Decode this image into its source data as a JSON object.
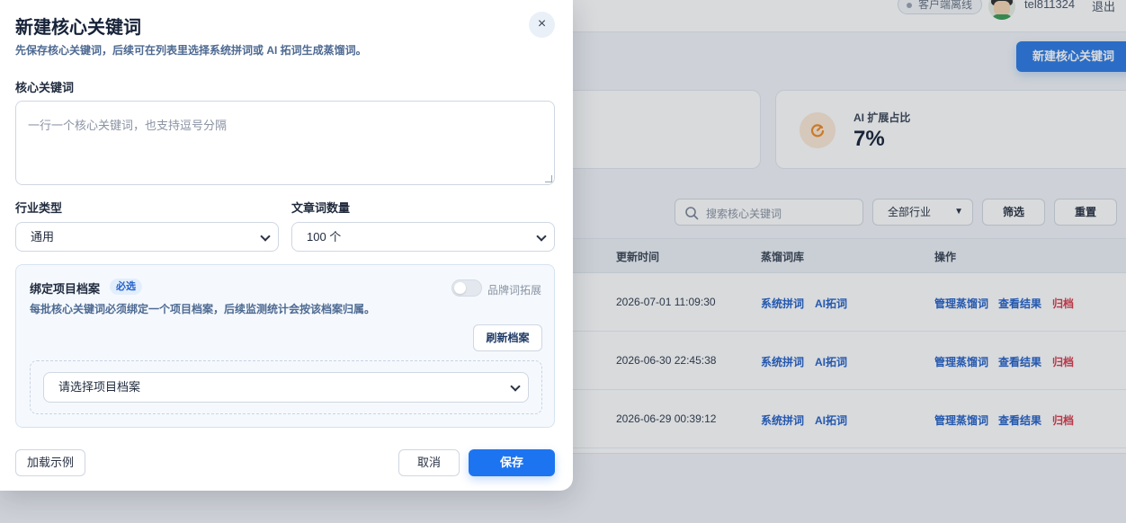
{
  "header": {
    "status": "客户端离线",
    "username": "tel811324",
    "logout": "退出",
    "new_keyword_button": "新建核心关键词"
  },
  "stats": {
    "ai_ratio_label": "AI 扩展占比",
    "ai_ratio_value": "7%",
    "accent": "#f08a24"
  },
  "filters": {
    "search_placeholder": "搜索核心关键词",
    "industry_value": "全部行业",
    "filter_button": "筛选",
    "reset_button": "重置"
  },
  "table": {
    "columns": [
      "更新时间",
      "蒸馏词库",
      "操作"
    ],
    "rows": [
      {
        "time": "2026-07-01 11:09:30",
        "lib_sys": "系统拼词",
        "lib_ai": "AI拓词",
        "act_manage": "管理蒸馏词",
        "act_view": "查看结果",
        "act_archive": "归档"
      },
      {
        "time": "2026-06-30 22:45:38",
        "lib_sys": "系统拼词",
        "lib_ai": "AI拓词",
        "act_manage": "管理蒸馏词",
        "act_view": "查看结果",
        "act_archive": "归档"
      },
      {
        "time": "2026-06-29 00:39:12",
        "lib_sys": "系统拼词",
        "lib_ai": "AI拓词",
        "act_manage": "管理蒸馏词",
        "act_view": "查看结果",
        "act_archive": "归档"
      }
    ]
  },
  "modal": {
    "title": "新建核心关键词",
    "subtitle": "先保存核心关键词，后续可在列表里选择系统拼词或 AI 拓词生成蒸馏词。",
    "close_icon": "×",
    "keyword_label": "核心关键词",
    "keyword_placeholder": "一行一个核心关键词，也支持逗号分隔",
    "industry_label": "行业类型",
    "industry_value": "通用",
    "count_label": "文章词数量",
    "count_value": "100 个",
    "project": {
      "title": "绑定项目档案",
      "required_badge": "必选",
      "toggle_label": "品牌词拓展",
      "toggle_on": false,
      "description": "每批核心关键词必须绑定一个项目档案，后续监测统计会按该档案归属。",
      "refresh_button": "刷新档案",
      "select_placeholder": "请选择项目档案"
    },
    "load_example_button": "加载示例",
    "cancel_button": "取消",
    "save_button": "保存",
    "primary_color": "#1d74f0"
  }
}
